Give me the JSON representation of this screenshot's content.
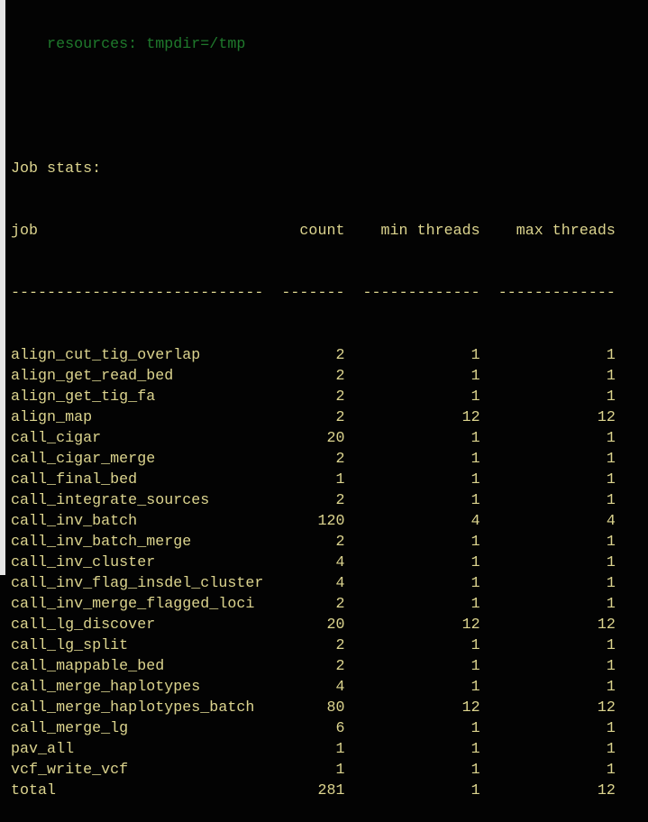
{
  "resources_line": "    resources: tmpdir=/tmp",
  "section_title": "Job stats:",
  "headers": {
    "job": "job",
    "count": "count",
    "min": "min threads",
    "max": "max threads"
  },
  "dashes": {
    "job": "----------------------------",
    "count": "-------",
    "min": "-------------",
    "max": "-------------"
  },
  "rows": [
    {
      "job": "align_cut_tig_overlap",
      "count": "2",
      "min": "1",
      "max": "1"
    },
    {
      "job": "align_get_read_bed",
      "count": "2",
      "min": "1",
      "max": "1"
    },
    {
      "job": "align_get_tig_fa",
      "count": "2",
      "min": "1",
      "max": "1"
    },
    {
      "job": "align_map",
      "count": "2",
      "min": "12",
      "max": "12"
    },
    {
      "job": "call_cigar",
      "count": "20",
      "min": "1",
      "max": "1"
    },
    {
      "job": "call_cigar_merge",
      "count": "2",
      "min": "1",
      "max": "1"
    },
    {
      "job": "call_final_bed",
      "count": "1",
      "min": "1",
      "max": "1"
    },
    {
      "job": "call_integrate_sources",
      "count": "2",
      "min": "1",
      "max": "1"
    },
    {
      "job": "call_inv_batch",
      "count": "120",
      "min": "4",
      "max": "4"
    },
    {
      "job": "call_inv_batch_merge",
      "count": "2",
      "min": "1",
      "max": "1"
    },
    {
      "job": "call_inv_cluster",
      "count": "4",
      "min": "1",
      "max": "1"
    },
    {
      "job": "call_inv_flag_insdel_cluster",
      "count": "4",
      "min": "1",
      "max": "1"
    },
    {
      "job": "call_inv_merge_flagged_loci",
      "count": "2",
      "min": "1",
      "max": "1"
    },
    {
      "job": "call_lg_discover",
      "count": "20",
      "min": "12",
      "max": "12"
    },
    {
      "job": "call_lg_split",
      "count": "2",
      "min": "1",
      "max": "1"
    },
    {
      "job": "call_mappable_bed",
      "count": "2",
      "min": "1",
      "max": "1"
    },
    {
      "job": "call_merge_haplotypes",
      "count": "4",
      "min": "1",
      "max": "1"
    },
    {
      "job": "call_merge_haplotypes_batch",
      "count": "80",
      "min": "12",
      "max": "12"
    },
    {
      "job": "call_merge_lg",
      "count": "6",
      "min": "1",
      "max": "1"
    },
    {
      "job": "pav_all",
      "count": "1",
      "min": "1",
      "max": "1"
    },
    {
      "job": "vcf_write_vcf",
      "count": "1",
      "min": "1",
      "max": "1"
    },
    {
      "job": "total",
      "count": "281",
      "min": "1",
      "max": "12"
    }
  ],
  "colors": {
    "text": "#dcd48e",
    "resources": "#1f7a2c",
    "background": "#030303"
  }
}
